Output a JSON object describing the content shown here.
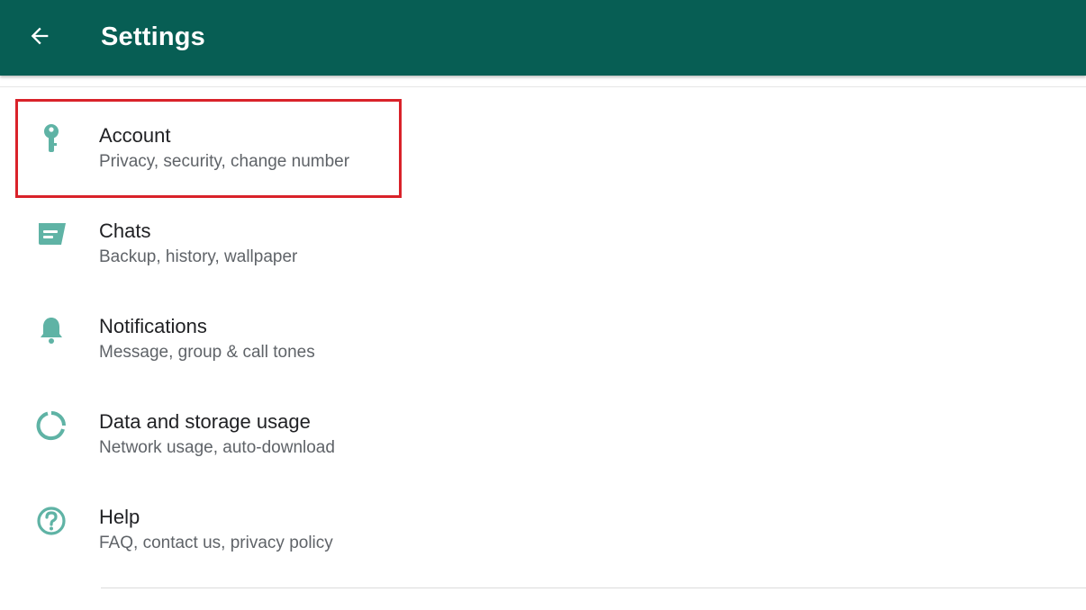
{
  "toolbar": {
    "title": "Settings",
    "back_icon": "arrow-back-icon",
    "background_color": "#075e54"
  },
  "accent_color": "#5fb3a5",
  "highlight_color": "#d9222a",
  "settings": [
    {
      "title": "Account",
      "subtitle": "Privacy, security, change number",
      "icon": "key-icon",
      "highlighted": true
    },
    {
      "title": "Chats",
      "subtitle": "Backup, history, wallpaper",
      "icon": "chat-icon"
    },
    {
      "title": "Notifications",
      "subtitle": "Message, group & call tones",
      "icon": "bell-icon"
    },
    {
      "title": "Data and storage usage",
      "subtitle": "Network usage, auto-download",
      "icon": "data-usage-icon"
    },
    {
      "title": "Help",
      "subtitle": "FAQ, contact us, privacy policy",
      "icon": "help-icon"
    }
  ]
}
